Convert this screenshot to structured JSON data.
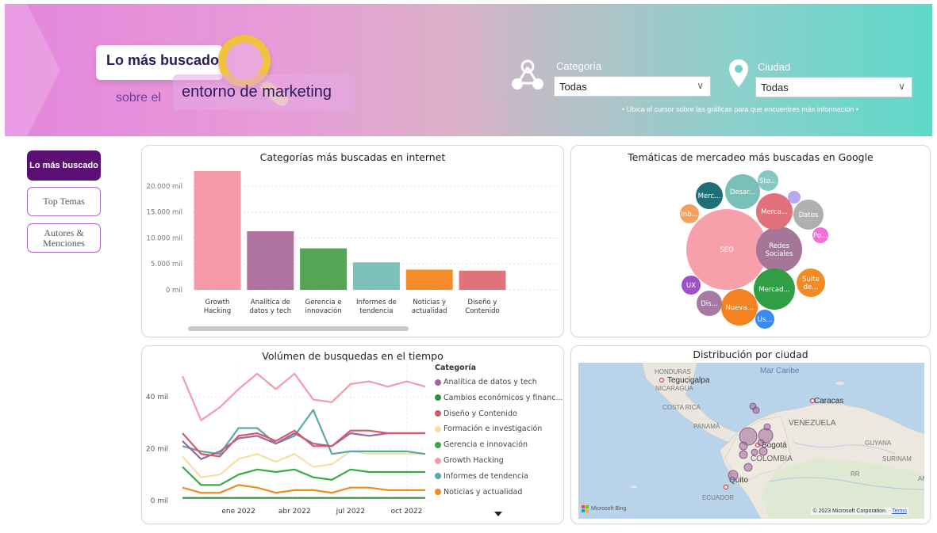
{
  "header": {
    "logo_title": "Lo más buscado",
    "logo_sub_prefix": "sobre el",
    "logo_sub_main": "entorno de marketing",
    "categoria_label": "Categoría",
    "categoria_value": "Todas",
    "ciudad_label": "Ciudad",
    "ciudad_value": "Todas",
    "hint": "• Ubica el cursor sobre las gráficas para que encuentres más información •"
  },
  "nav": {
    "items": [
      {
        "label": "Lo más buscado",
        "active": true
      },
      {
        "label": "Top Temas",
        "active": false
      },
      {
        "label": "Autores & Menciones",
        "active": false
      }
    ]
  },
  "cards": {
    "bar_title": "Categorías más buscadas en internet",
    "bubble_title": "Temáticas de mercadeo más buscadas en Google",
    "line_title": "Volúmen de busquedas en el tiempo",
    "map_title": "Distribución por ciudad"
  },
  "legend": {
    "title": "Categoría",
    "items": [
      {
        "label": "Analítica de datos y tech",
        "color": "#a0679a"
      },
      {
        "label": "Cambios económicos y financ...",
        "color": "#2f8f3a"
      },
      {
        "label": "Diseño y Contenido",
        "color": "#d45a6a"
      },
      {
        "label": "Formación e investigación",
        "color": "#f5e0a3"
      },
      {
        "label": "Gerencia e innovación",
        "color": "#3aa845"
      },
      {
        "label": "Growth Hacking",
        "color": "#f59aa8"
      },
      {
        "label": "Informes de tendencia",
        "color": "#5aa8a8"
      },
      {
        "label": "Noticias y actualidad",
        "color": "#f08a1e"
      }
    ]
  },
  "chart_data": [
    {
      "type": "bar",
      "title": "Categorías más buscadas en internet",
      "categories": [
        "Growth Hacking",
        "Analítica de datos y tech",
        "Gerencia e innovación",
        "Informes de tendencia",
        "Noticias y actualidad",
        "Diseño y Contenido"
      ],
      "category_lines": [
        [
          "Growth",
          "Hacking"
        ],
        [
          "Analítica de",
          "datos y tech"
        ],
        [
          "Gerencia e",
          "innovación"
        ],
        [
          "Informes de",
          "tendencia"
        ],
        [
          "Noticias y",
          "actualidad"
        ],
        [
          "Diseño y",
          "Contenido"
        ]
      ],
      "values": [
        22900,
        11300,
        8000,
        5300,
        3900,
        3700
      ],
      "colors": [
        "#f59aa8",
        "#b0729e",
        "#56a556",
        "#7cc0bc",
        "#f68b2a",
        "#e0727a"
      ],
      "ylim": [
        0,
        22900
      ],
      "yticks": [
        0,
        5000,
        10000,
        15000,
        20000
      ],
      "ytick_labels": [
        "0 mil",
        "5.000 mil",
        "10.000 mil",
        "15.000 mil",
        "20.000 mil"
      ],
      "grid": true
    },
    {
      "type": "scatter",
      "subtype": "bubble",
      "title": "Temáticas de mercadeo más buscadas en Google",
      "bubbles": [
        {
          "label": "SEO",
          "color": "#f7a0aa"
        },
        {
          "label": "Redes Sociales",
          "color": "#a57698"
        },
        {
          "label": "Mercad...",
          "color": "#2f9e45"
        },
        {
          "label": "Nueva...",
          "color": "#f58220"
        },
        {
          "label": "Desar...",
          "color": "#78c0b8"
        },
        {
          "label": "Merca...",
          "color": "#e0707a"
        },
        {
          "label": "Merc...",
          "color": "#1f6f78"
        },
        {
          "label": "Datos",
          "color": "#b0b0b0"
        },
        {
          "label": "Suite de...",
          "color": "#f58a22"
        },
        {
          "label": "Dis...",
          "color": "#a87aa2"
        },
        {
          "label": "Sto...",
          "color": "#86c8c4"
        },
        {
          "label": "Inb...",
          "color": "#f4a060"
        },
        {
          "label": "UX",
          "color": "#a050c8"
        },
        {
          "label": "Us...",
          "color": "#3a8af0"
        },
        {
          "label": "Po...",
          "color": "#f070d8"
        },
        {
          "label": "",
          "color": "#b8a8f0"
        }
      ]
    },
    {
      "type": "line",
      "title": "Volúmen de busquedas en el tiempo",
      "x": [
        "2021-10",
        "2021-11",
        "2021-12",
        "2022-01",
        "2022-02",
        "2022-03",
        "2022-04",
        "2022-05",
        "2022-06",
        "2022-07",
        "2022-08",
        "2022-09",
        "2022-10",
        "2022-11"
      ],
      "xtick_labels": [
        "ene 2022",
        "abr 2022",
        "jul 2022",
        "oct 2022"
      ],
      "ylim": [
        0,
        52
      ],
      "ytick_labels": [
        "0 mil",
        "20 mil",
        "40 mil"
      ],
      "yticks": [
        0,
        20,
        40
      ],
      "series": [
        {
          "name": "Growth Hacking",
          "color": "#f59aa8",
          "values": [
            48,
            31,
            36,
            43,
            49,
            43,
            49,
            39,
            38,
            45,
            46,
            44,
            46,
            44
          ]
        },
        {
          "name": "Diseño y Contenido",
          "color": "#d45a6a",
          "values": [
            26,
            18,
            17,
            25,
            26,
            23,
            27,
            21,
            21,
            27,
            27,
            26,
            26,
            26
          ]
        },
        {
          "name": "Analítica de datos y tech",
          "color": "#a0679a",
          "values": [
            23,
            16,
            19,
            24,
            25,
            22,
            26,
            22,
            21,
            26,
            25,
            26,
            26,
            26
          ]
        },
        {
          "name": "Informes de tendencia",
          "color": "#5aa8a8",
          "values": [
            21,
            19,
            18,
            28,
            28,
            22,
            25,
            35,
            18,
            19,
            19,
            19,
            19,
            18
          ]
        },
        {
          "name": "Formación e investigación",
          "color": "#f5e0a3",
          "values": [
            17,
            9,
            10,
            16,
            18,
            15,
            18,
            13,
            14,
            19,
            18,
            18,
            18,
            18
          ]
        },
        {
          "name": "Gerencia e innovación",
          "color": "#3aa845",
          "values": [
            13,
            6,
            6,
            10,
            12,
            11,
            12,
            9,
            8,
            12,
            11,
            11,
            11,
            11
          ]
        },
        {
          "name": "Noticias y actualidad",
          "color": "#f08a1e",
          "values": [
            5,
            3,
            3,
            6,
            5,
            3,
            4,
            4,
            3,
            5,
            5,
            4,
            4,
            4
          ]
        },
        {
          "name": "Cambios económicos y financ...",
          "color": "#2f8f3a",
          "values": [
            1,
            1,
            1,
            1,
            1,
            1,
            1,
            1,
            1,
            1,
            1,
            1,
            1,
            1
          ]
        }
      ]
    }
  ],
  "map": {
    "labels": {
      "honduras": "HONDURAS",
      "tegucigalpa": "Tegucigalpa",
      "nicaragua": "NICARAGUA",
      "mar_caribe": "Mar Caribe",
      "caracas": "Caracas",
      "costa_rica": "COSTA RICA",
      "panama": "PANAMÁ",
      "venezuela": "VENEZUELA",
      "bogota": "Bogotá",
      "colombia": "COLOMBIA",
      "guyana": "GUYANA",
      "surinam": "SURINAM",
      "rr": "RR",
      "am": "AM",
      "quito": "Quito",
      "ecuador": "ECUADOR"
    },
    "bing": "Microsoft Bing",
    "copyright": "© 2023 Microsoft Corporation",
    "terms": "Terms",
    "bubble_color": "#a0679a"
  }
}
